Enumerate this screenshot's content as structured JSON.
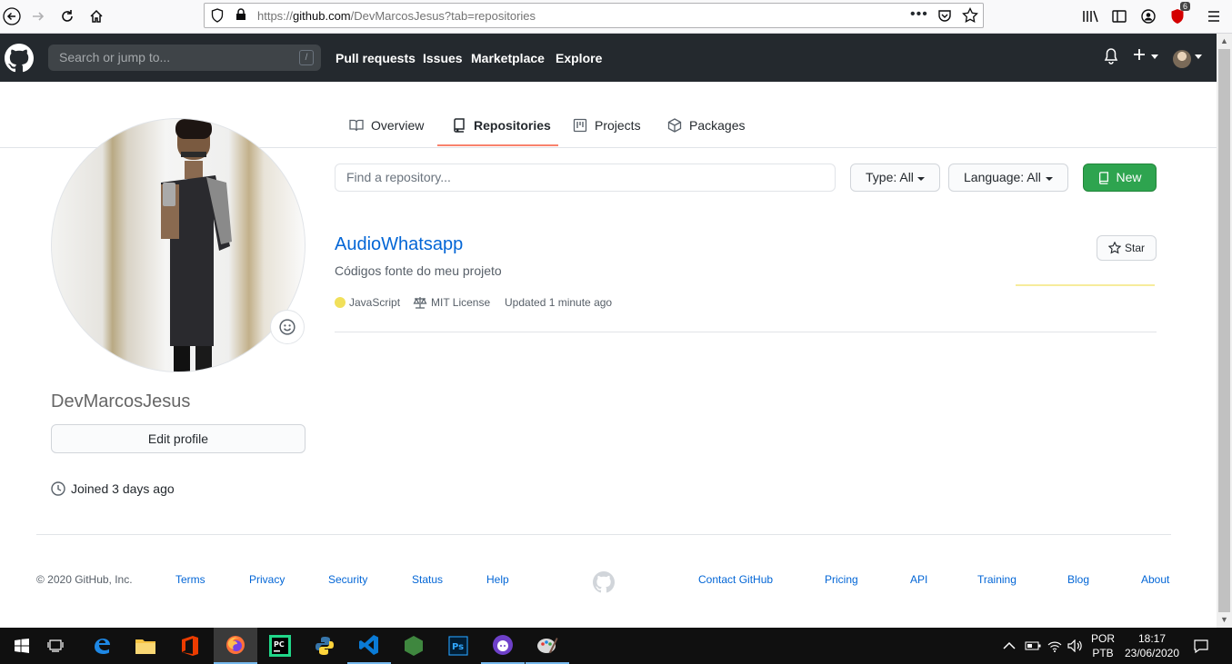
{
  "browser": {
    "url_prefix": "https://",
    "url_domain": "github.com",
    "url_path": "/DevMarcosJesus?tab=repositories",
    "notification_count": "6"
  },
  "header": {
    "search_placeholder": "Search or jump to...",
    "search_shortcut": "/",
    "nav": [
      "Pull requests",
      "Issues",
      "Marketplace",
      "Explore"
    ]
  },
  "tabs": [
    {
      "label": "Overview",
      "icon": "book-icon"
    },
    {
      "label": "Repositories",
      "icon": "repo-icon",
      "active": true
    },
    {
      "label": "Projects",
      "icon": "project-icon"
    },
    {
      "label": "Packages",
      "icon": "package-icon"
    }
  ],
  "profile": {
    "username": "DevMarcosJesus",
    "edit_label": "Edit profile",
    "joined": "Joined 3 days ago"
  },
  "repo_toolbar": {
    "search_placeholder": "Find a repository...",
    "type_filter": "Type: All",
    "language_filter": "Language: All",
    "new_label": "New"
  },
  "repos": [
    {
      "name": "AudioWhatsapp",
      "description": "Códigos fonte do meu projeto",
      "language": "JavaScript",
      "language_color": "#f1e05a",
      "license": "MIT License",
      "updated": "Updated 1 minute ago",
      "star_label": "Star"
    }
  ],
  "footer": {
    "copyright": "© 2020 GitHub, Inc.",
    "left_links": [
      "Terms",
      "Privacy",
      "Security",
      "Status",
      "Help"
    ],
    "right_links": [
      "Contact GitHub",
      "Pricing",
      "API",
      "Training",
      "Blog",
      "About"
    ]
  },
  "taskbar": {
    "lang_top": "POR",
    "lang_bottom": "PTB",
    "time": "18:17",
    "date": "23/06/2020"
  },
  "colors": {
    "header_bg": "#24292e",
    "link": "#0366d6",
    "new_button": "#2ea44f",
    "tab_underline": "#f9826c"
  }
}
